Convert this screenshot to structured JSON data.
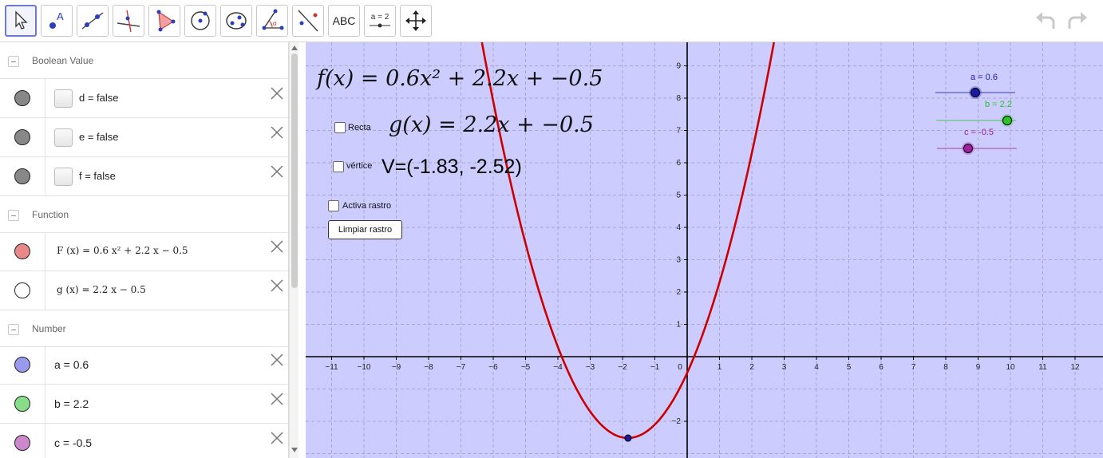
{
  "toolbar": {
    "text_tool_label": "ABC",
    "slider_tool_label": "a = 2"
  },
  "algebra": {
    "groups": {
      "boolean": "Boolean Value",
      "function": "Function",
      "number": "Number"
    },
    "booleans": [
      {
        "label": "d = false"
      },
      {
        "label": "e = false"
      },
      {
        "label": "f = false"
      }
    ],
    "functions": [
      {
        "label": "F (x)  =  0.6 x² + 2.2 x − 0.5",
        "color": "#e88888"
      },
      {
        "label": "g (x)  =  2.2 x − 0.5",
        "color": "#ffffff"
      }
    ],
    "numbers": [
      {
        "label": "a = 0.6",
        "color": "#9999ee"
      },
      {
        "label": "b = 2.2",
        "color": "#88dd88"
      },
      {
        "label": "c = -0.5",
        "color": "#cc88cc"
      }
    ]
  },
  "graphics": {
    "formula_f": "f(x) = 0.6x² + 2.2x + −0.5",
    "formula_g": "g(x) = 2.2x + −0.5",
    "checkbox_recta": "Recta",
    "checkbox_vertice": "vértice",
    "vertex_text": "V=(-1.83, -2.52)",
    "checkbox_rastro": "Activa rastro",
    "clear_button": "Limpiar rastro",
    "sliders": [
      {
        "label": "a = 0.6",
        "color": "#1a1aa6",
        "value": 0.6
      },
      {
        "label": "b = 2.2",
        "color": "#2bc42b",
        "value": 2.2
      },
      {
        "label": "c = -0.5",
        "color": "#a020a0",
        "value": -0.5
      }
    ],
    "vertex": {
      "x": -1.83,
      "y": -2.52
    },
    "curve_color": "#cc0000",
    "background_color": "#ccccff",
    "x_ticks": [
      "−11",
      "−10",
      "−9",
      "−8",
      "−7",
      "−6",
      "−5",
      "−4",
      "−3",
      "−2",
      "−1",
      "0",
      "1",
      "2",
      "3",
      "4",
      "5",
      "6",
      "7",
      "8",
      "9",
      "10",
      "11",
      "12"
    ],
    "y_ticks": [
      "9",
      "8",
      "7",
      "6",
      "5",
      "4",
      "3",
      "2",
      "1",
      "−2"
    ],
    "coef": {
      "a": 0.6,
      "b": 2.2,
      "c": -0.5
    }
  }
}
